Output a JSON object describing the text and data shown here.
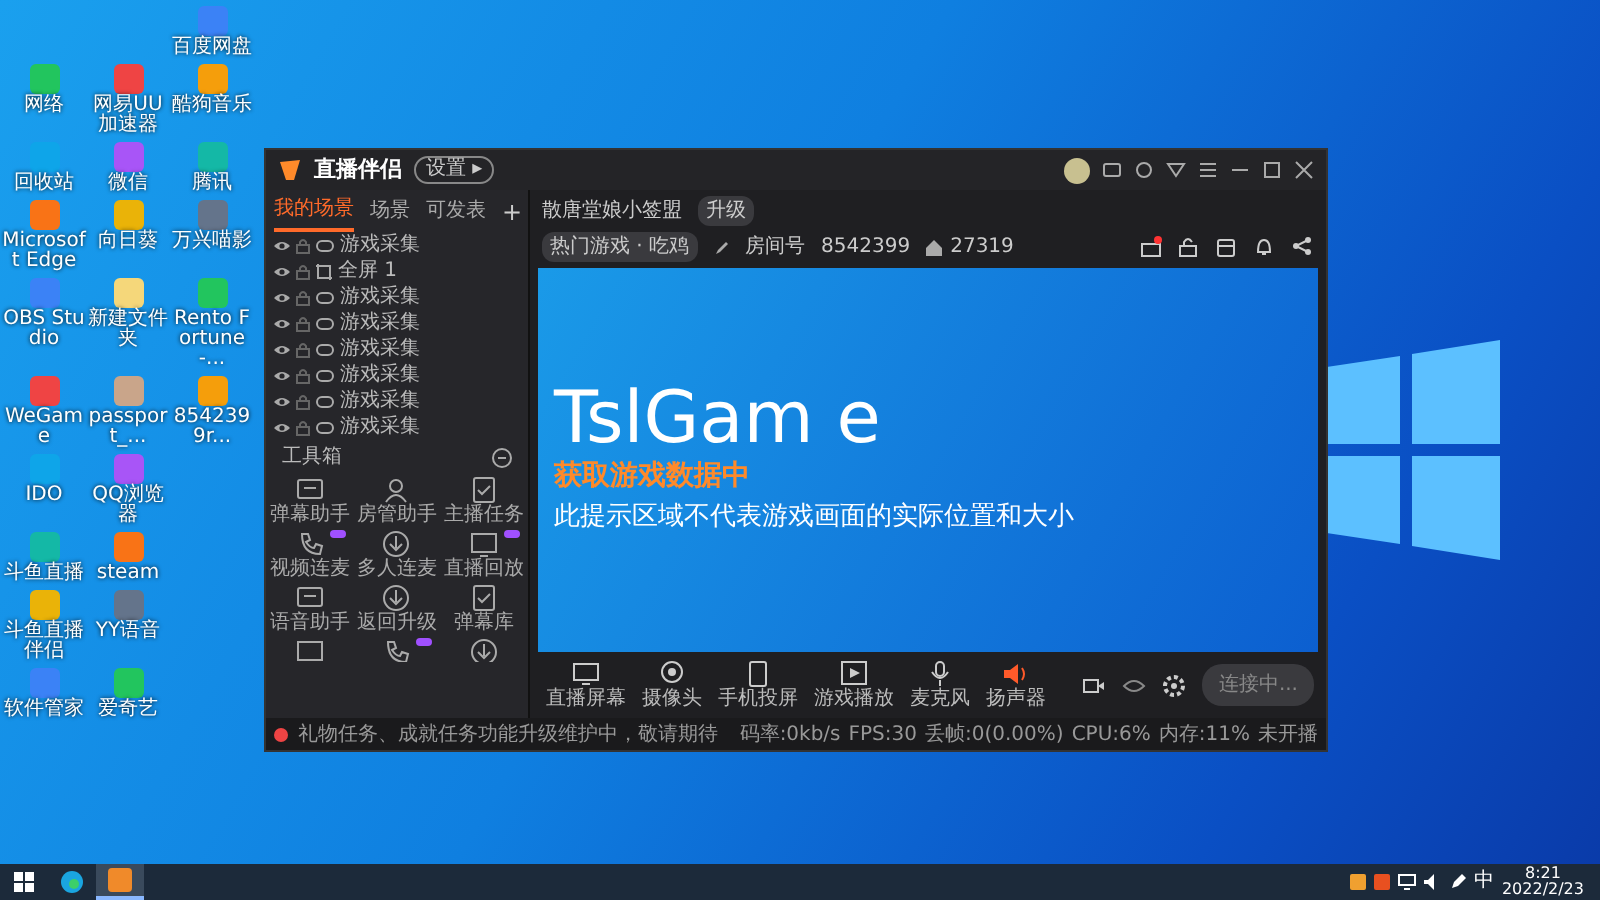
{
  "desktop": {
    "rows": [
      [
        {
          "kind": "empty"
        },
        {
          "kind": "empty"
        },
        {
          "kind": "app",
          "label": "百度网盘"
        }
      ],
      [
        {
          "kind": "app",
          "label": "网络"
        },
        {
          "kind": "app",
          "label": "网易UU加速器"
        },
        {
          "kind": "app",
          "label": "酷狗音乐"
        }
      ],
      [
        {
          "kind": "app",
          "label": "回收站"
        },
        {
          "kind": "app",
          "label": "微信"
        },
        {
          "kind": "app",
          "label": "腾讯"
        }
      ],
      [
        {
          "kind": "app",
          "label": "Microsoft Edge"
        },
        {
          "kind": "app",
          "label": "向日葵"
        },
        {
          "kind": "app",
          "label": "万兴喵影"
        }
      ],
      [
        {
          "kind": "app",
          "label": "OBS Studio"
        },
        {
          "kind": "folder",
          "label": "新建文件夹"
        },
        {
          "kind": "app",
          "label": "Rento Fortune -..."
        }
      ],
      [
        {
          "kind": "app",
          "label": "WeGame"
        },
        {
          "kind": "photo",
          "label": "passport_..."
        },
        {
          "kind": "app",
          "label": "8542399r..."
        }
      ],
      [
        {
          "kind": "app",
          "label": "IDO"
        },
        {
          "kind": "app",
          "label": "QQ浏览器"
        }
      ],
      [
        {
          "kind": "app",
          "label": "斗鱼直播"
        },
        {
          "kind": "app",
          "label": "steam"
        }
      ],
      [
        {
          "kind": "app",
          "label": "斗鱼直播伴侣"
        },
        {
          "kind": "app",
          "label": "YY语音"
        }
      ],
      [
        {
          "kind": "app",
          "label": "软件管家"
        },
        {
          "kind": "app",
          "label": "爱奇艺"
        }
      ]
    ]
  },
  "app": {
    "title": "直播伴侣",
    "title_badge": "设置 ▸",
    "scene_tabs": [
      {
        "label": "我的场景",
        "selected": true
      },
      {
        "label": "场景",
        "selected": false
      },
      {
        "label": "可发表",
        "selected": false
      }
    ],
    "add_scene": "+",
    "sources": [
      {
        "kind": "game",
        "label": "游戏采集"
      },
      {
        "kind": "screen",
        "label": "全屏 1"
      },
      {
        "kind": "game",
        "label": "游戏采集"
      },
      {
        "kind": "game",
        "label": "游戏采集"
      },
      {
        "kind": "game",
        "label": "游戏采集"
      },
      {
        "kind": "game",
        "label": "游戏采集"
      },
      {
        "kind": "game",
        "label": "游戏采集"
      },
      {
        "kind": "game",
        "label": "游戏采集"
      }
    ],
    "toolbox_title": "工具箱",
    "tools": [
      {
        "kind": "chat",
        "label": "弹幕助手",
        "new": false
      },
      {
        "kind": "user",
        "label": "房管助手",
        "new": false
      },
      {
        "kind": "task",
        "label": "主播任务",
        "new": false
      },
      {
        "kind": "call",
        "label": "视频连麦",
        "new": true
      },
      {
        "kind": "download",
        "label": "多人连麦",
        "new": false
      },
      {
        "kind": "screen",
        "label": "直播回放",
        "new": true
      },
      {
        "kind": "chat",
        "label": "语音助手",
        "new": false
      },
      {
        "kind": "download",
        "label": "返回升级",
        "new": false
      },
      {
        "kind": "task",
        "label": "弹幕库",
        "new": false
      },
      {
        "kind": "screen",
        "new": false
      },
      {
        "kind": "call",
        "new": true
      },
      {
        "kind": "download",
        "new": false
      }
    ],
    "stream_title": "散唐堂娘小签盟",
    "stream_tag": "升级",
    "category": "热门游戏 · 吃鸡",
    "room_label": "房间号",
    "room_number": "8542399",
    "popularity": "27319",
    "preview": {
      "game_name": "TslGam e",
      "loading": "获取游戏数据中",
      "notice": "此提示区域不代表游戏画面的实际位置和大小"
    },
    "controls": [
      {
        "kind": "screen",
        "label": "直播屏幕"
      },
      {
        "kind": "camera",
        "label": "摄像头"
      },
      {
        "kind": "phone",
        "label": "手机投屏"
      },
      {
        "kind": "play",
        "label": "游戏播放"
      },
      {
        "kind": "mic",
        "label": "麦克风"
      },
      {
        "kind": "speaker",
        "label": "扬声器"
      }
    ],
    "start_button": "连接中...",
    "notice": "礼物任务、成就任务功能升级维护中，敬请期待",
    "stats": [
      "码率:0kb/s",
      "FPS:30",
      "丢帧:0(0.00%)",
      "CPU:6%",
      "内存:11%",
      "未开播"
    ]
  },
  "taskbar": {
    "apps": [
      {
        "kind": "edge",
        "active": false
      },
      {
        "kind": "app",
        "active": true
      }
    ],
    "ime": "中",
    "time": "8:21",
    "date": "2022/2/23"
  }
}
